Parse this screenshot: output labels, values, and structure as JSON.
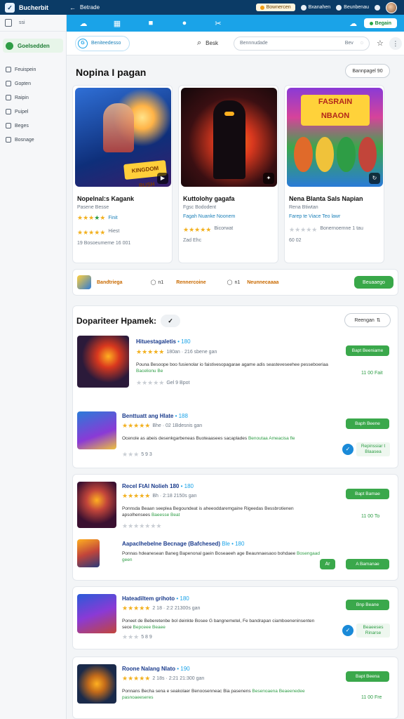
{
  "titlebar": {
    "app_name": "Bucherbit",
    "nav_back": "←",
    "nav_label": "Betrade",
    "pill_label": "Bownercen",
    "item1": "Bxanahen",
    "item2": "Beunbenau",
    "icons": [
      "logo-icon",
      "back-icon",
      "avatar"
    ]
  },
  "sidebar": {
    "top_label": "ssi",
    "active_label": "Goelsedden",
    "items": [
      {
        "label": "Feuispein",
        "icon": "home-icon"
      },
      {
        "label": "Gopten",
        "icon": "doc-icon"
      },
      {
        "label": "Raipin",
        "icon": "list-icon"
      },
      {
        "label": "Puipel",
        "icon": "folder-icon"
      },
      {
        "label": "Beges",
        "icon": "page-icon"
      },
      {
        "label": "Bosnage",
        "icon": "settings-icon"
      }
    ]
  },
  "toolbar": {
    "buttons": [
      "☁",
      "▦",
      "■",
      "●",
      "✂"
    ],
    "sync_label": "Begain",
    "accent": "#1aa3e8"
  },
  "header": {
    "tab_icon": "G",
    "tab_label": "Beniteedesso",
    "search_label": "Besk",
    "search_placeholder": "Bennnudade",
    "search_hint": "Bev"
  },
  "featured": {
    "title": "Nopina I pagan",
    "action": "Bannpagel 90",
    "cards": [
      {
        "title": "Nopelnal:s Kagank",
        "sub": "Pasene Besse",
        "stars": "★★★★★",
        "rating_label": "Finit",
        "meta": "Hiest",
        "meta2": "19 Bosoeumeme 16 001"
      },
      {
        "title": "Kuttolohy gagafa",
        "sub": "Fgsc Bododent",
        "stars": "★★★★★",
        "rating_label": "Fagah Nuanke Noonem",
        "meta": "Bicorwat",
        "meta2": "Zad Ehc"
      },
      {
        "title": "Nena Blanta Sals Napian",
        "sub": "Rena Btiwtan",
        "stars": "★★★★★",
        "rating_label": "Farep te Viace Teo lawr",
        "meta": "Bonernoemne 1 tau",
        "meta2": "60 02"
      }
    ]
  },
  "strip": {
    "label": "Bandtriega",
    "opt1": "n1",
    "opt1_label": "Rennercoine",
    "opt2": "n1",
    "opt2_label": "Neunnecaaaa",
    "button": "Beuaaego"
  },
  "list": {
    "title": "Dopariteer Hpamek:",
    "sort_label": "Reengan",
    "rows": [
      {
        "title": "Hituestagaletis",
        "version": "• 180",
        "rating": "★★★★★",
        "rating_text": "180an · 216 sbene gan",
        "desc": "Pouna Besoope boo fusienolar io faistivesopagarae agame adis seasteveseehee pesseboeriaa",
        "desc_hl": "Bacelionu Be",
        "meta": "Gel 9 Bpot",
        "button": "Bapt Beeniame",
        "side": "11 00 Fait"
      },
      {
        "title": "Benttuatt ang Hlate",
        "version": "• 188",
        "rating": "★★★★★",
        "rating_text": "Bhe · 02 1Bdesnis gan",
        "desc": "Ocenole as abeis desenkgarbeneas Buoteaasees sacaplades",
        "desc_hl": "Benoutaa Ameacisa fle",
        "meta": "5 9 3",
        "button": "Baph Beene",
        "side": "Repinssiar t Blaasea"
      },
      {
        "title": "Recel FtAl Nolieh 180",
        "version": "• 180",
        "rating": "★★★★★",
        "rating_text": "Bh · 2:18 2150s gan",
        "desc": "Ponnsda Beaan seeplea Begoundeat is aheeoddaremgaine Rigeedas Bessbrotienen apsolhensees",
        "desc_hl": "Baeesse Beat",
        "meta": "4 4 4 4 4 4",
        "button": "Bapt Bamae",
        "side": "11 00 To"
      },
      {
        "title": "Aapaclhebelne Becnage (Bafchesed)",
        "version": "Ble • 180",
        "rating": "",
        "rating_text": "",
        "desc": "Ponnas hdeanesean Baneg Bapenonal gaein Boseaeeh age Beaunnaesaoo bohdaee",
        "desc_hl": "Bosengaad geen",
        "meta": "",
        "button": "A Bamanae",
        "side": "Ar"
      },
      {
        "title": "Hateadiltem grihoto",
        "version": "• 180",
        "rating": "★★★★★",
        "rating_text": "2 18 · 2:2 21300s gan",
        "desc": "Poneet de Beberetenbe bol deinkte Bosee G bangnemetel, Fe bandrapan ciamboeneninsenten sece",
        "desc_hl": "Bepceee Beaee",
        "meta": "5 8 9",
        "button": "Bnp Beane",
        "side": "Beaeeses Rinarse"
      },
      {
        "title": "Roone Nalang Nlato",
        "version": "• 190",
        "rating": "★★★★★",
        "rating_text": "2 18s · 2:21 21:300 gan",
        "desc": "Ponnans Becha sena e seakolaer Benoosenneac Bia pasenens",
        "desc_hl": "Besenoaena Beaeenedee pasnoaeeseres",
        "meta": "",
        "button": "Bapt Beena",
        "side": "11 00 Fre"
      }
    ]
  }
}
